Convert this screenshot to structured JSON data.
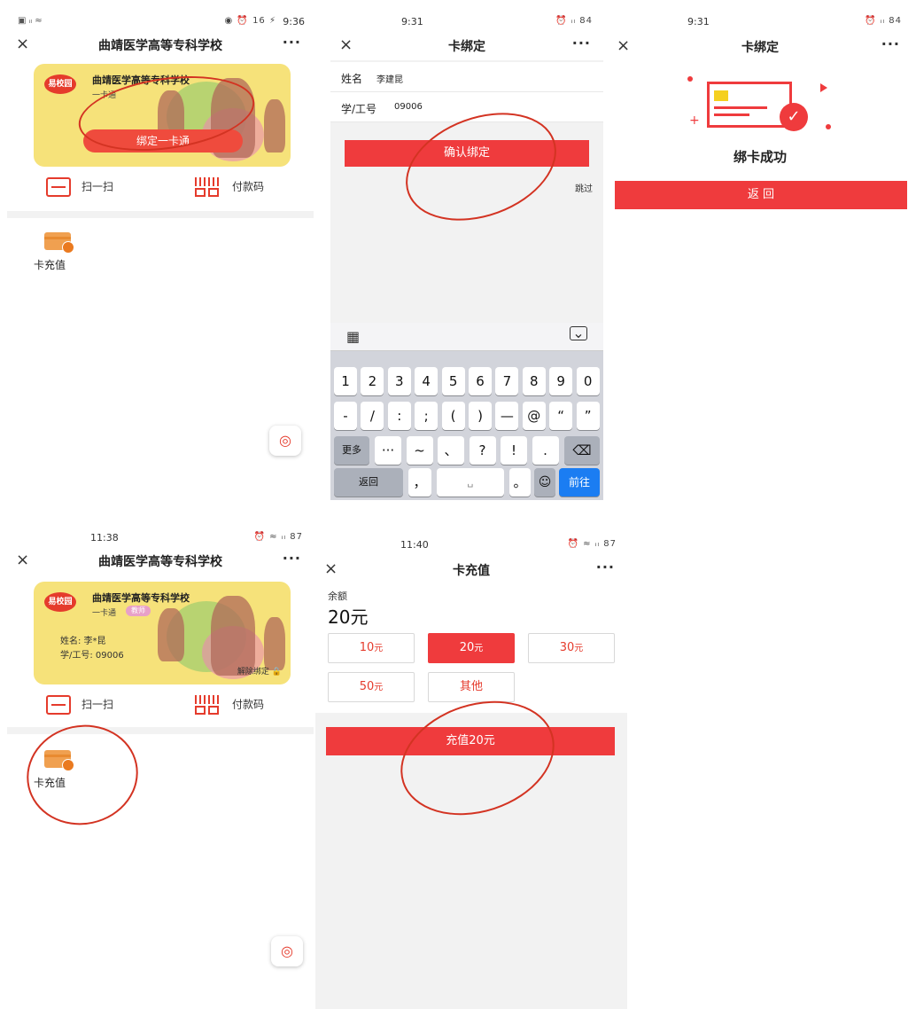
{
  "panel1": {
    "status_time": "9:36",
    "status_icons": "◉ ⏰ 16 ⚡",
    "status_left": "▣ ᵢₗ ≈",
    "nav_title": "曲靖医学高等专科学校",
    "close_glyph": "×",
    "more_glyph": "···",
    "card_logo": "易校园",
    "card_school": "曲靖医学高等专科学校",
    "card_sub": "一卡通",
    "bind_button": "绑定一卡通",
    "scan_label": "扫一扫",
    "paycode_label": "付款码",
    "recharge_label": "卡充值",
    "float_glyph": "◎"
  },
  "panel2": {
    "status_time": "9:31",
    "status_icons": "⏰ ᵢₗ 84",
    "nav_title": "卡绑定",
    "close_glyph": "×",
    "more_glyph": "···",
    "name_label": "姓名",
    "name_value": "李建昆",
    "id_label": "学/工号",
    "id_value": "09006",
    "confirm_button": "确认绑定",
    "skip_link": "跳过",
    "keyboard": {
      "grid_glyph": "▦",
      "hide_glyph": "⌄",
      "row1": [
        "1",
        "2",
        "3",
        "4",
        "5",
        "6",
        "7",
        "8",
        "9",
        "0"
      ],
      "row2": [
        "-",
        "/",
        ":",
        ";",
        "(",
        ")",
        "—",
        "@",
        "“",
        "”"
      ],
      "row3_more": "更多",
      "row3": [
        "···",
        "~",
        "、",
        "?",
        "!",
        "."
      ],
      "row3_delete": "⌫",
      "row4_back": "返回",
      "row4_comma": "，",
      "row4_space": "␣",
      "row4_period": "。",
      "row4_emoji": "☺",
      "row4_go": "前往"
    }
  },
  "panel3": {
    "status_time": "9:31",
    "status_icons": "⏰ ᵢₗ 84",
    "nav_title": "卡绑定",
    "close_glyph": "×",
    "more_glyph": "···",
    "success_text": "绑卡成功",
    "back_button": "返 回"
  },
  "panel4": {
    "status_time": "11:38",
    "status_icons": "⏰ ≈ ᵢₗ 87",
    "nav_title": "曲靖医学高等专科学校",
    "close_glyph": "×",
    "more_glyph": "···",
    "card_logo": "易校园",
    "card_school": "曲靖医学高等专科学校",
    "card_sub": "一卡通",
    "card_badge": "教师",
    "card_name": "姓名: 李*昆",
    "card_id": "学/工号: 09006",
    "unbind_label": "解除绑定",
    "lock_glyph": "🔒",
    "scan_label": "扫一扫",
    "paycode_label": "付款码",
    "recharge_label": "卡充值",
    "float_glyph": "◎"
  },
  "panel5": {
    "status_time": "11:40",
    "status_icons": "⏰ ≈ ᵢₗ 87",
    "nav_title": "卡充值",
    "close_glyph": "×",
    "more_glyph": "···",
    "balance_label": "余额",
    "balance_value": "20元",
    "amounts": [
      {
        "num": "10",
        "unit": "元"
      },
      {
        "num": "20",
        "unit": "元"
      },
      {
        "num": "30",
        "unit": "元"
      },
      {
        "num": "50",
        "unit": "元"
      }
    ],
    "other_label": "其他",
    "recharge_button": "充值20元"
  },
  "colors": {
    "accent": "#ef3b3d",
    "card": "#f6e27a",
    "annotation": "#d33322",
    "keyboard_go": "#1b7df2"
  }
}
